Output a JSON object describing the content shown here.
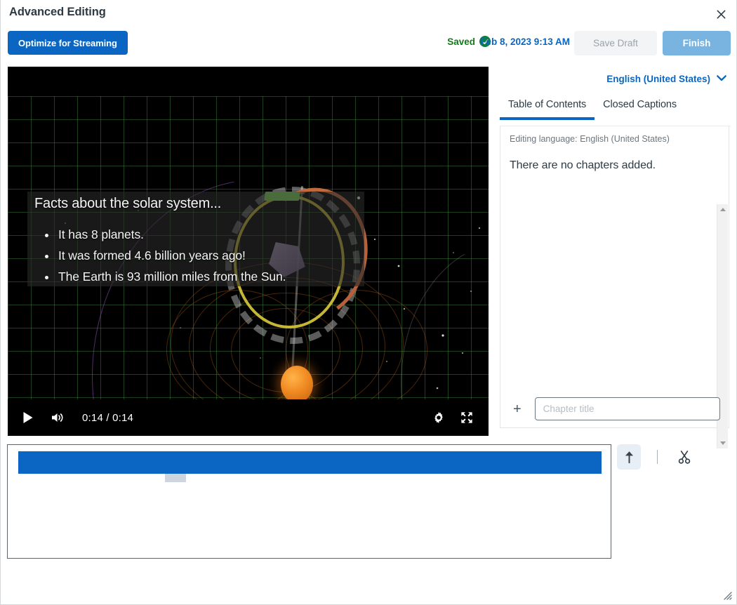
{
  "window": {
    "title": "Advanced Editing",
    "close_icon": "close-icon"
  },
  "actionbar": {
    "optimize_label": "Optimize for Streaming",
    "saved_label": "Saved",
    "saved_icon": "check-circle-icon",
    "date_label": "Feb 8, 2023 9:13 AM",
    "date_chevron_icon": "chevron-down-icon",
    "save_draft_label": "Save Draft",
    "finish_label": "Finish",
    "colors": {
      "primary_blue": "#0a66c2",
      "saved_green": "#127a1b",
      "finish_blue": "#79b4e0",
      "draft_gray": "#f2f4f6"
    }
  },
  "player": {
    "caption_title": "Facts about the solar system...",
    "caption_bullets": [
      "It has 8 planets.",
      "It was formed 4.6 billion years ago!",
      "The Earth is 93 million miles from the Sun."
    ],
    "play_icon": "play-icon",
    "volume_icon": "volume-icon",
    "time_display": "0:14 / 0:14",
    "current_time": "0:14",
    "duration": "0:14",
    "settings_icon": "gear-icon",
    "fullscreen_icon": "fullscreen-icon"
  },
  "rightpanel": {
    "language_label": "English (United States)",
    "language_chevron_icon": "chevron-down-icon",
    "tabs": [
      {
        "label": "Table of Contents",
        "active": true
      },
      {
        "label": "Closed Captions",
        "active": false
      }
    ],
    "editing_language": "Editing language: English (United States)",
    "empty_message": "There are no chapters added.",
    "add_icon": "plus-icon",
    "chapter_placeholder": "Chapter title",
    "chapter_value": "",
    "scroll_up_icon": "triangle-up-icon",
    "scroll_down_icon": "triangle-down-icon"
  },
  "timeline": {
    "clip_color": "#0a66c2",
    "marker_color": "#ced5de",
    "upload_icon": "upload-arrow-icon",
    "cut_icon": "scissors-icon"
  },
  "footer": {
    "resize_icon": "resize-grip-icon"
  }
}
